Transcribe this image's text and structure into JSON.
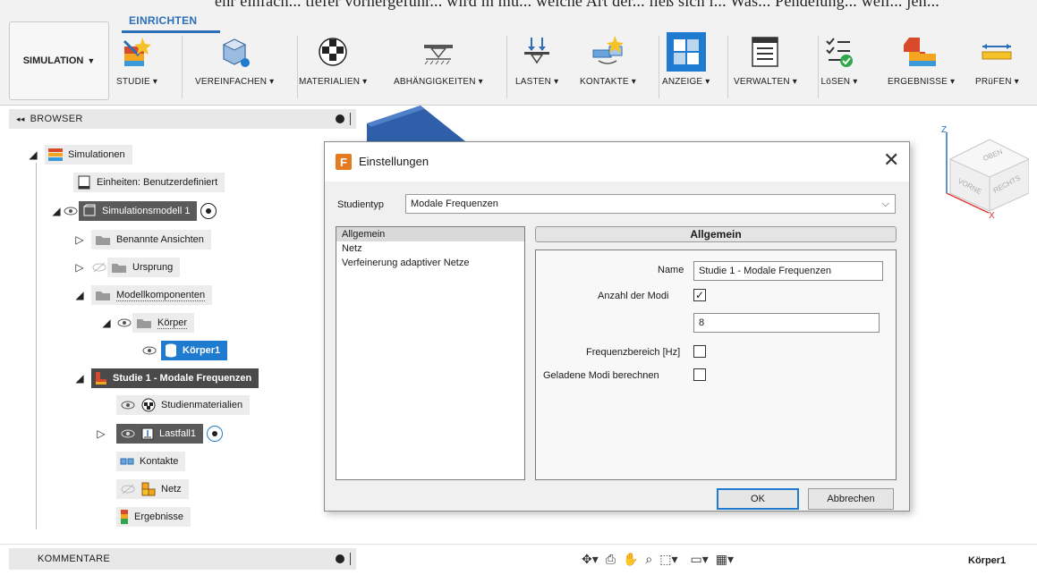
{
  "top_strip_clip": "ehr einfach... tiefer vorhergeführ... wird in mu... welche Art der... ließ sich i... Was... Pendelung... weil... jen...",
  "ribbon": {
    "active_tab": "EINRICHTEN",
    "simulation_button": "SIMULATION",
    "tools": [
      {
        "label": "STUDIE ▾"
      },
      {
        "label": "VEREINFACHEN ▾"
      },
      {
        "label": "MATERIALIEN ▾"
      },
      {
        "label": "ABHÄNGIGKEITEN ▾"
      },
      {
        "label": "LASTEN ▾"
      },
      {
        "label": "KONTAKTE ▾"
      },
      {
        "label": "ANZEIGE ▾"
      },
      {
        "label": "VERWALTEN ▾"
      },
      {
        "label": "LöSEN ▾"
      },
      {
        "label": "ERGEBNISSE ▾"
      },
      {
        "label": "PRüFEN ▾"
      }
    ]
  },
  "browser": {
    "title": "BROWSER",
    "items": {
      "simulationen": "Simulationen",
      "einheiten": "Einheiten: Benutzerdefiniert",
      "simulationsmodell": "Simulationsmodell 1",
      "benannte_ansichten": "Benannte Ansichten",
      "ursprung": "Ursprung",
      "modellkomponenten": "Modellkomponenten",
      "koerper_folder": "Körper",
      "koerper1": "Körper1",
      "studie1": "Studie 1 - Modale Frequenzen",
      "studienmaterialien": "Studienmaterialien",
      "lastfall1": "Lastfall1",
      "kontakte": "Kontakte",
      "netz": "Netz",
      "ergebnisse": "Ergebnisse"
    }
  },
  "dialog": {
    "title": "Einstellungen",
    "close": "✕",
    "study_type_label": "Studientyp",
    "study_type_value": "Modale Frequenzen",
    "categories": [
      "Allgemein",
      "Netz",
      "Verfeinerung adaptiver Netze"
    ],
    "pane_title": "Allgemein",
    "fields": {
      "name_label": "Name",
      "name_value": "Studie 1 - Modale Frequenzen",
      "modes_label": "Anzahl der Modi",
      "modes_value": "8",
      "freq_label": "Frequenzbereich [Hz]",
      "loaded_label": "Geladene Modi berechnen"
    },
    "ok": "OK",
    "cancel": "Abbrechen"
  },
  "bottom": {
    "comments": "KOMMENTARE",
    "body_label": "Körper1"
  },
  "viewcube": {
    "top": "OBEN",
    "front": "VORNE",
    "right": "RECHTS",
    "z": "Z",
    "x": "X"
  },
  "colors": {
    "accent": "#2c6fb6",
    "selection": "#1e7bd0"
  }
}
